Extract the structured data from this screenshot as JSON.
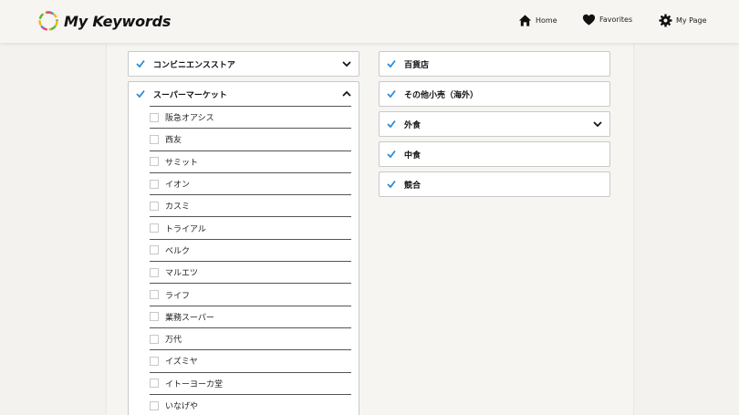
{
  "app": {
    "title": "My Keywords"
  },
  "nav": {
    "home": "Home",
    "favorites": "Favorites",
    "my_page": "My Page"
  },
  "left_categories": [
    {
      "label": "コンビニエンスストア",
      "checked": true,
      "expanded": false
    },
    {
      "label": "スーパーマーケット",
      "checked": true,
      "expanded": true
    }
  ],
  "supermarket_items": [
    {
      "label": "阪急オアシス",
      "checked": false
    },
    {
      "label": "西友",
      "checked": false
    },
    {
      "label": "サミット",
      "checked": false
    },
    {
      "label": "イオン",
      "checked": false
    },
    {
      "label": "カスミ",
      "checked": false
    },
    {
      "label": "トライアル",
      "checked": false
    },
    {
      "label": "ベルク",
      "checked": false
    },
    {
      "label": "マルエツ",
      "checked": false
    },
    {
      "label": "ライフ",
      "checked": false
    },
    {
      "label": "業務スーパー",
      "checked": false
    },
    {
      "label": "万代",
      "checked": false
    },
    {
      "label": "イズミヤ",
      "checked": false
    },
    {
      "label": "イトーヨーカ堂",
      "checked": false
    },
    {
      "label": "いなげや",
      "checked": false
    }
  ],
  "right_categories": [
    {
      "label": "百貨店",
      "checked": true
    },
    {
      "label": "その他小売（海外）",
      "checked": true
    },
    {
      "label": "外食",
      "checked": true,
      "has_chevron": true
    },
    {
      "label": "中食",
      "checked": true
    },
    {
      "label": "競合",
      "checked": true
    }
  ],
  "colors": {
    "check": "#2b8bd6",
    "border": "#c9c9c9",
    "background": "#f3f2ee"
  }
}
